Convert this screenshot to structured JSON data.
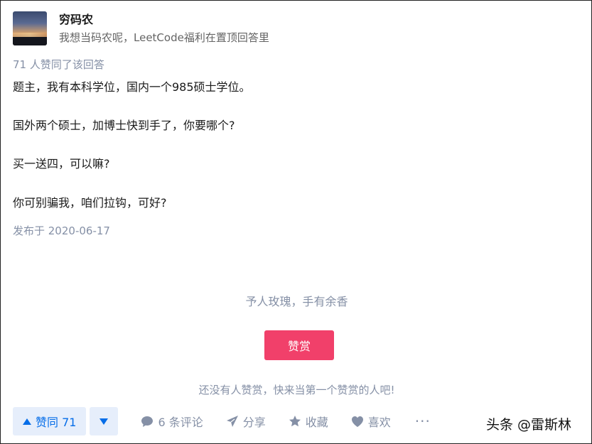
{
  "author": {
    "name": "穷码农",
    "bio": "我想当码农呢，LeetCode福利在置顶回答里"
  },
  "vote_summary": "71 人赞同了该回答",
  "content": {
    "paragraphs": [
      "题主，我有本科学位，国内一个985硕士学位。",
      "国外两个硕士，加博士快到手了，你要哪个?",
      "买一送四，可以嘛?",
      "你可别骗我，咱们拉钩，可好?"
    ]
  },
  "publish_time": "发布于 2020-06-17",
  "reward": {
    "slogan": "予人玫瑰，手有余香",
    "button_label": "赞赏",
    "note": "还没有人赞赏，快来当第一个赞赏的人吧!"
  },
  "actions": {
    "vote_up_label": "赞同 71",
    "comment_label": "6 条评论",
    "share_label": "分享",
    "collect_label": "收藏",
    "like_label": "喜欢",
    "more_label": "···"
  },
  "watermark": "头条 @雷斯林",
  "colors": {
    "accent_blue": "#056de8",
    "reward_pink": "#f1406a",
    "meta_gray": "#8590a6"
  }
}
